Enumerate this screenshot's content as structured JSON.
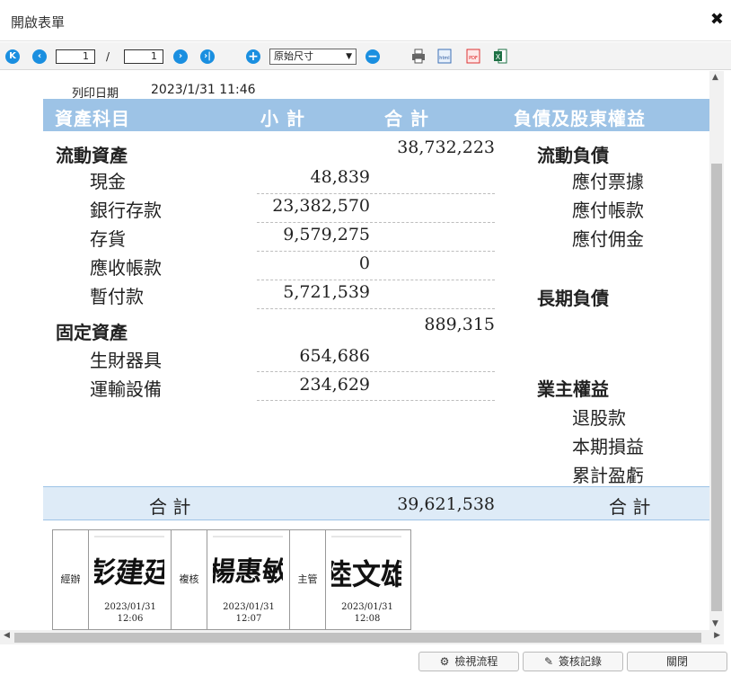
{
  "window": {
    "title": "開啟表單",
    "close_glyph": "✖"
  },
  "toolbar": {
    "current_page": "1",
    "page_separator": "/",
    "total_pages": "1",
    "zoom_value": "原始尺寸",
    "icons": [
      "first-page-icon",
      "prev-page-icon",
      "next-page-icon",
      "last-page-icon",
      "zoom-in-icon",
      "zoom-out-icon",
      "print-icon",
      "html-export-icon",
      "pdf-export-icon",
      "excel-export-icon"
    ],
    "html_label": "html",
    "pdf_label": "PDF"
  },
  "report": {
    "print_date_label": "列印日期",
    "print_date_value": "2023/1/31 11:46",
    "headers": {
      "asset": "資產科目",
      "subtotal": "小 計",
      "total": "合 計",
      "liability": "負債及股東權益"
    },
    "assets": {
      "current": {
        "label": "流動資產",
        "total": "38,732,223",
        "items": [
          {
            "label": "現金",
            "value": "48,839"
          },
          {
            "label": "銀行存款",
            "value": "23,382,570"
          },
          {
            "label": "存貨",
            "value": "9,579,275"
          },
          {
            "label": "應收帳款",
            "value": "0"
          },
          {
            "label": "暫付款",
            "value": "5,721,539"
          }
        ]
      },
      "fixed": {
        "label": "固定資產",
        "total": "889,315",
        "items": [
          {
            "label": "生財器具",
            "value": "654,686"
          },
          {
            "label": "運輸設備",
            "value": "234,629"
          }
        ]
      }
    },
    "liabilities": {
      "current": {
        "label": "流動負債",
        "items": [
          "應付票據",
          "應付帳款",
          "應付佣金"
        ]
      },
      "long_term": {
        "label": "長期負債"
      },
      "equity": {
        "label": "業主權益",
        "items": [
          "退股款",
          "本期損益",
          "累計盈虧"
        ]
      }
    },
    "grand_total": {
      "label_left": "合 計",
      "value": "39,621,538",
      "label_right": "合 計"
    },
    "signatures": [
      {
        "role": "經辦",
        "name": "彭建廷",
        "date": "2023/01/31",
        "time": "12:06"
      },
      {
        "role": "複核",
        "name": "楊惠敏",
        "date": "2023/01/31",
        "time": "12:07"
      },
      {
        "role": "主管",
        "name": "陸文雄",
        "date": "2023/01/31",
        "time": "12:08"
      }
    ]
  },
  "footer": {
    "view_flow": "檢視流程",
    "sign_record": "簽核記錄",
    "close": "關閉"
  },
  "colors": {
    "header_band": "#9dc3e6",
    "total_band": "#deebf7",
    "nav_blue": "#1a8fe0"
  }
}
